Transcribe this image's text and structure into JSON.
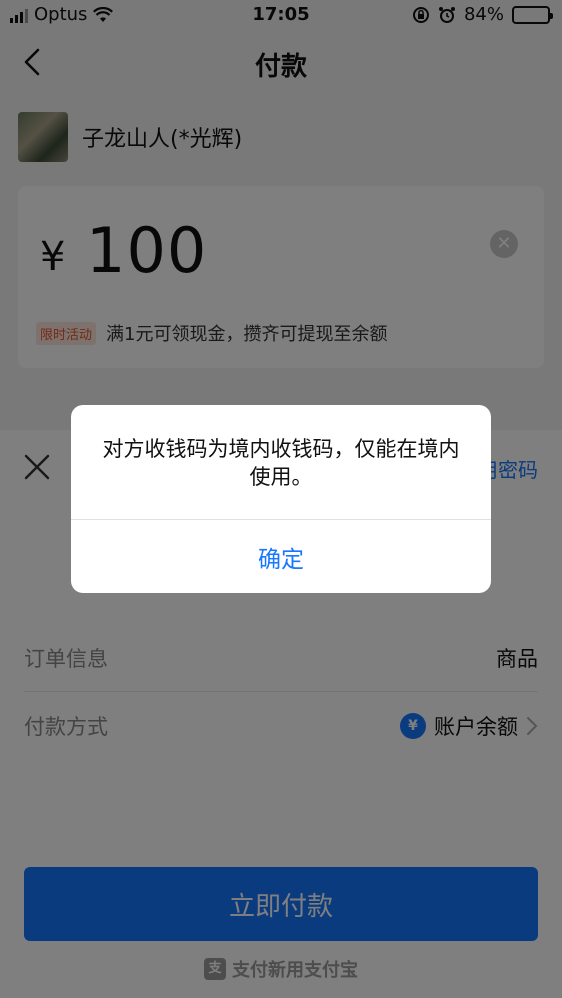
{
  "status_bar": {
    "carrier": "Optus",
    "time": "17:05",
    "battery": "84%"
  },
  "nav": {
    "title": "付款"
  },
  "payee": {
    "name": "子龙山人(*光辉)"
  },
  "amount_card": {
    "currency_symbol": "¥",
    "amount": "100",
    "promo_tag": "限时活动",
    "promo_text": "满1元可领现金，攒齐可提现至余额"
  },
  "sheet": {
    "password_link": "用密码",
    "order_label": "订单信息",
    "order_value": "商品",
    "method_label": "付款方式",
    "method_icon_glyph": "¥",
    "method_value": "账户余额",
    "pay_button": "立即付款",
    "footer_logo_glyph": "支",
    "footer_text": "支付新用支付宝"
  },
  "dialog": {
    "message": "对方收钱码为境内收钱码，仅能在境内使用。",
    "confirm": "确定"
  },
  "colors": {
    "accent": "#1677ff",
    "promo": "#e8542a"
  }
}
